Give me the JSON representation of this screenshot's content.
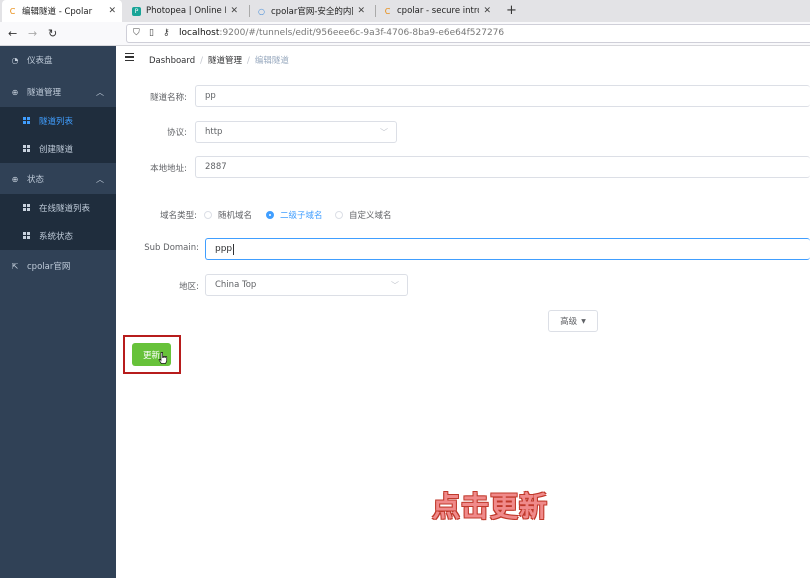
{
  "browser": {
    "tabs": [
      {
        "title": "编辑隧道 - Cpolar",
        "icon": "cpolar-icon",
        "close": "✕"
      },
      {
        "title": "Photopea | Online Photo",
        "icon": "photopea-icon",
        "close": "✕"
      },
      {
        "title": "cpolar官网-安全的内网穿",
        "icon": "search-icon",
        "close": "✕"
      },
      {
        "title": "cpolar - secure introspect",
        "icon": "cpolar-icon",
        "close": "✕"
      }
    ],
    "new_tab": "+",
    "url_host": "localhost",
    "url_rest": ":9200/#/tunnels/edit/956eee6c-9a3f-4706-8ba9-e6e64f527276"
  },
  "sidebar": {
    "items": [
      {
        "label": "仪表盘",
        "icon": "dashboard-icon"
      },
      {
        "label": "隧道管理",
        "icon": "plus-circle-icon"
      },
      {
        "label": "隧道列表",
        "icon": "grid-icon"
      },
      {
        "label": "创建隧道",
        "icon": "grid-icon"
      },
      {
        "label": "状态",
        "icon": "plus-circle-icon"
      },
      {
        "label": "在线隧道列表",
        "icon": "grid-icon"
      },
      {
        "label": "系统状态",
        "icon": "grid-icon"
      },
      {
        "label": "cpolar官网",
        "icon": "external-link-icon"
      }
    ]
  },
  "breadcrumb": {
    "home": "Dashboard",
    "section": "隧道管理",
    "current": "编辑隧道",
    "sep": "/"
  },
  "form": {
    "name_label": "隧道名称:",
    "name_value": "pp",
    "protocol_label": "协议:",
    "protocol_value": "http",
    "local_label": "本地地址:",
    "local_value": "2887",
    "domain_type_label": "域名类型:",
    "domain_options": [
      "随机域名",
      "二级子域名",
      "自定义域名"
    ],
    "subdomain_label": "Sub Domain:",
    "subdomain_value": "ppp",
    "region_label": "地区:",
    "region_value": "China Top",
    "advanced_label": "高级",
    "update_label": "更新"
  },
  "annotation": "点击更新",
  "colors": {
    "sidebar_bg": "#304156",
    "accent": "#409eff",
    "update_green": "#67c23a",
    "highlight_red": "#b71c1c"
  }
}
